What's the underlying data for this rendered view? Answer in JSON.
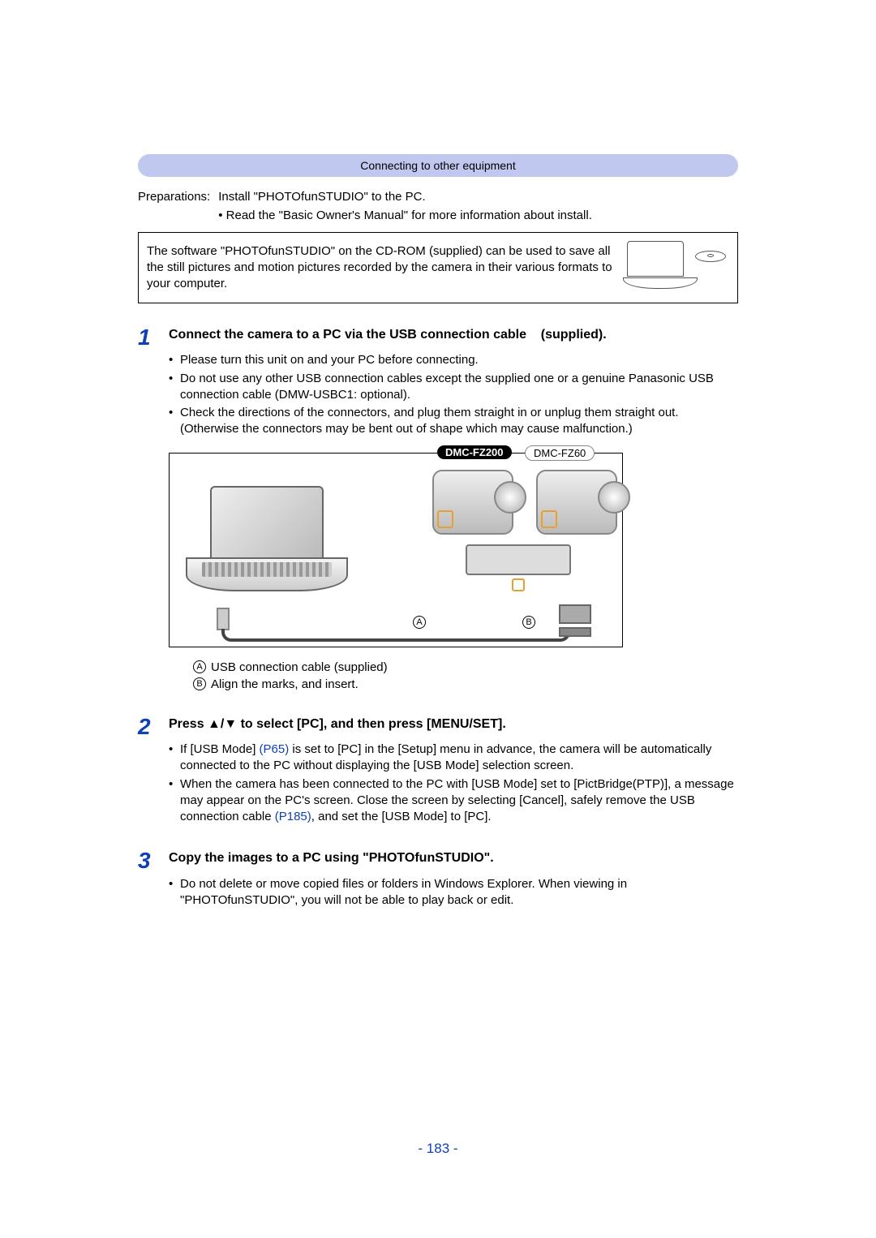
{
  "header": "Connecting to other equipment",
  "preparations": {
    "label": "Preparations:",
    "line1": "Install \"PHOTOfunSTUDIO\" to the PC.",
    "sub": "• Read the \"Basic Owner's Manual\" for more information about install."
  },
  "info_box": "The software \"PHOTOfunSTUDIO\" on the CD-ROM (supplied) can be used to save all the still pictures and motion pictures recorded by the camera in their various formats to your computer.",
  "steps": [
    {
      "num": "1",
      "title_a": "Connect the camera to a PC via the USB connection cable",
      "title_b": "(supplied).",
      "bullets": [
        "Please turn this unit on and your PC before connecting.",
        "Do not use any other USB connection cables except the supplied one or a genuine Panasonic USB connection cable (DMW-USBC1: optional).",
        "Check the directions of the connectors, and plug them straight in or unplug them straight out. (Otherwise the connectors may be bent out of shape which may cause malfunction.)"
      ],
      "models": {
        "active": "DMC-FZ200",
        "other": "DMC-FZ60"
      },
      "labels": {
        "A": "A",
        "B": "B"
      },
      "captions": {
        "A": "USB connection cable (supplied)",
        "B": "Align the marks, and insert."
      }
    },
    {
      "num": "2",
      "title": "Press ▲/▼ to select [PC], and then press [MENU/SET].",
      "bullets_rich": [
        {
          "pre": "If [USB Mode] ",
          "link": "(P65)",
          "post": " is set to [PC] in the [Setup] menu in advance, the camera will be automatically connected to the PC without displaying the [USB Mode] selection screen."
        },
        {
          "pre": "When the camera has been connected to the PC with [USB Mode] set to [PictBridge(PTP)], a message may appear on the PC's screen. Close the screen by selecting [Cancel], safely remove the USB connection cable ",
          "link": "(P185)",
          "post": ", and set the [USB Mode] to [PC]."
        }
      ]
    },
    {
      "num": "3",
      "title": "Copy the images to a PC using \"PHOTOfunSTUDIO\".",
      "bullets": [
        "Do not delete or move copied files or folders in Windows Explorer. When viewing in \"PHOTOfunSTUDIO\", you will not be able to play back or edit."
      ]
    }
  ],
  "page_number": "- 183 -"
}
